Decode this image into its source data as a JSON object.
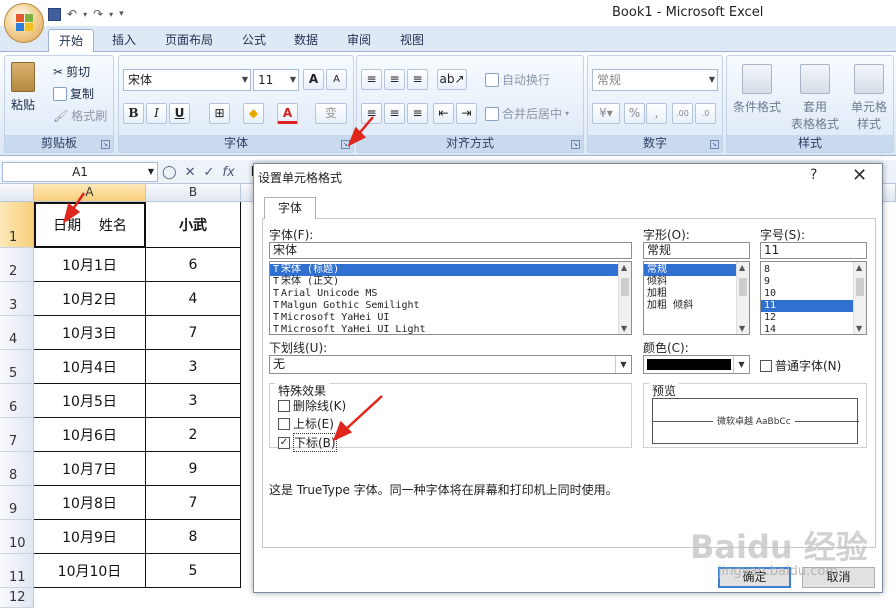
{
  "app": {
    "title": "Book1 - Microsoft Excel"
  },
  "tabs": [
    "开始",
    "插入",
    "页面布局",
    "公式",
    "数据",
    "审阅",
    "视图"
  ],
  "ribbon": {
    "clipboard": {
      "paste": "粘贴",
      "cut": "剪切",
      "copy": "复制",
      "format_painter": "格式刷",
      "label": "剪贴板"
    },
    "font": {
      "font_name": "宋体",
      "font_size": "11",
      "grow": "A",
      "shrink": "A",
      "bold": "B",
      "italic": "I",
      "underline": "U",
      "font_color": "A",
      "phonetic": "变",
      "label": "字体"
    },
    "alignment": {
      "wrap": "自动换行",
      "merge": "合并后居中",
      "label": "对齐方式"
    },
    "number": {
      "format": "常规",
      "percent": "%",
      "comma": ",",
      "label": "数字"
    },
    "styles": {
      "conditional": "条件格式",
      "table_line1": "套用",
      "table_line2": "表格格式",
      "cell_line1": "单元格",
      "cell_line2": "样式",
      "label": "样式"
    }
  },
  "formula_bar": {
    "name_box": "A1",
    "fx": "fx",
    "content": "E"
  },
  "sheet": {
    "columns": [
      "A",
      "B"
    ],
    "rows": [
      "1",
      "2",
      "3",
      "4",
      "5",
      "6",
      "7",
      "8",
      "9",
      "10",
      "11",
      "12"
    ],
    "header": {
      "a1": "日期    姓名",
      "b1": "小武"
    },
    "dates": [
      "10月1日",
      "10月2日",
      "10月3日",
      "10月4日",
      "10月5日",
      "10月6日",
      "10月7日",
      "10月8日",
      "10月9日",
      "10月10日"
    ],
    "values": [
      "6",
      "4",
      "7",
      "3",
      "3",
      "2",
      "9",
      "7",
      "8",
      "5"
    ]
  },
  "dialog": {
    "title": "设置单元格格式",
    "help": "?",
    "close": "✕",
    "tab": "字体",
    "font_label": "字体(F):",
    "font_value": "宋体",
    "font_list": [
      "宋体 (标题)",
      "宋体 (正文)",
      "Arial Unicode MS",
      "Malgun Gothic Semilight",
      "Microsoft YaHei UI",
      "Microsoft YaHei UI Light"
    ],
    "style_label": "字形(O):",
    "style_value": "常规",
    "style_list": [
      "常规",
      "倾斜",
      "加粗",
      "加粗 倾斜"
    ],
    "size_label": "字号(S):",
    "size_value": "11",
    "size_list": [
      "8",
      "9",
      "10",
      "11",
      "12",
      "14"
    ],
    "underline_label": "下划线(U):",
    "underline_value": "无",
    "color_label": "颜色(C):",
    "normal_font": "普通字体(N)",
    "effects_label": "特殊效果",
    "strike": "删除线(K)",
    "superscript": "上标(E)",
    "subscript": "下标(B)",
    "subscript_checked": "✓",
    "preview_label": "预览",
    "preview_text": "微软卓越  AaBbCc",
    "note": "这是 TrueType 字体。同一种字体将在屏幕和打印机上同时使用。",
    "ok": "确定",
    "cancel": "取消"
  },
  "watermark": {
    "brand": "Baidu 经验",
    "url": "jingyan.baidu.com"
  },
  "colors": {
    "annotation_arrow": "#e0261b",
    "selection": "#3070d0",
    "ribbon_bg": "#dbe7f5"
  }
}
